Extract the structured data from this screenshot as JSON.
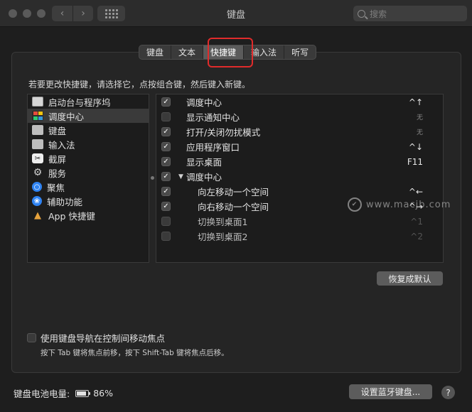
{
  "window": {
    "title": "键盘"
  },
  "search": {
    "placeholder": "搜索"
  },
  "tabs": [
    {
      "label": "键盘",
      "active": false
    },
    {
      "label": "文本",
      "active": false
    },
    {
      "label": "快捷键",
      "active": true
    },
    {
      "label": "输入法",
      "active": false
    },
    {
      "label": "听写",
      "active": false
    }
  ],
  "instruction": "若要更改快捷键，请选择它，点按组合键，然后键入新键。",
  "categories": [
    {
      "label": "启动台与程序坞",
      "icon": "launchpad-icon",
      "selected": false
    },
    {
      "label": "调度中心",
      "icon": "mission-control-icon",
      "selected": true
    },
    {
      "label": "键盘",
      "icon": "keyboard-icon",
      "selected": false
    },
    {
      "label": "输入法",
      "icon": "input-method-icon",
      "selected": false
    },
    {
      "label": "截屏",
      "icon": "screenshot-icon",
      "selected": false
    },
    {
      "label": "服务",
      "icon": "gear-icon",
      "selected": false
    },
    {
      "label": "聚焦",
      "icon": "spotlight-icon",
      "selected": false
    },
    {
      "label": "辅助功能",
      "icon": "accessibility-icon",
      "selected": false
    },
    {
      "label": "App 快捷键",
      "icon": "app-shortcuts-icon",
      "selected": false
    }
  ],
  "shortcuts": [
    {
      "label": "调度中心",
      "key": "^↑",
      "checked": true,
      "indent": false,
      "group": false,
      "disabled": false
    },
    {
      "label": "显示通知中心",
      "key": "无",
      "checked": false,
      "indent": false,
      "group": false,
      "disabled": false
    },
    {
      "label": "打开/关闭勿扰模式",
      "key": "无",
      "checked": true,
      "indent": false,
      "group": false,
      "disabled": false
    },
    {
      "label": "应用程序窗口",
      "key": "^↓",
      "checked": true,
      "indent": false,
      "group": false,
      "disabled": false
    },
    {
      "label": "显示桌面",
      "key": "F11",
      "checked": true,
      "indent": false,
      "group": false,
      "disabled": false
    },
    {
      "label": "调度中心",
      "key": "",
      "checked": true,
      "indent": false,
      "group": true,
      "disabled": false
    },
    {
      "label": "向左移动一个空间",
      "key": "^←",
      "checked": true,
      "indent": true,
      "group": false,
      "disabled": false
    },
    {
      "label": "向右移动一个空间",
      "key": "^→",
      "checked": true,
      "indent": true,
      "group": false,
      "disabled": false
    },
    {
      "label": "切换到桌面1",
      "key": "^1",
      "checked": false,
      "indent": true,
      "group": false,
      "disabled": true
    },
    {
      "label": "切换到桌面2",
      "key": "^2",
      "checked": false,
      "indent": true,
      "group": false,
      "disabled": true
    }
  ],
  "restore_button": "恢复成默认",
  "watermark": "www.macjb.com",
  "keyboard_nav": {
    "label": "使用键盘导航在控制间移动焦点",
    "checked": false,
    "hint": "按下 Tab 键将焦点前移，按下 Shift-Tab 键将焦点后移。"
  },
  "battery": {
    "label": "键盘电池电量:",
    "value": "86%",
    "level": 0.86
  },
  "bluetooth_button": "设置蓝牙键盘...",
  "help_button": "?",
  "colors": {
    "accent_highlight": "#e02b2b",
    "spotlight": "#2f83f2"
  }
}
